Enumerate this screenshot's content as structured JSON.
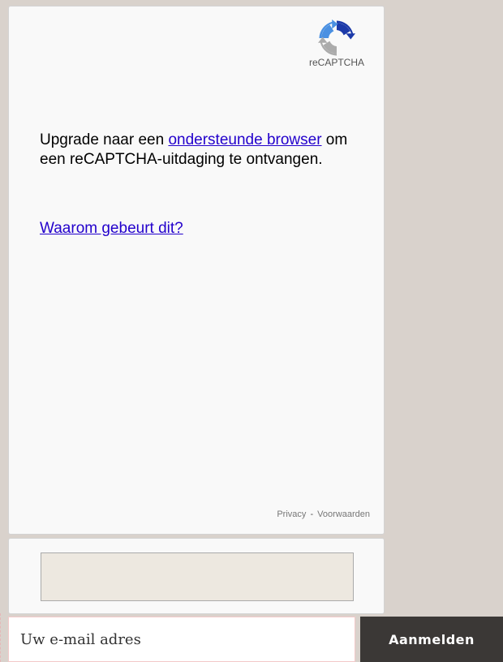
{
  "recaptcha": {
    "logo_label": "reCAPTCHA",
    "message_before": "Upgrade naar een ",
    "message_link": "ondersteunde browser",
    "message_after": " om een reCAPTCHA-uitdaging te ontvangen.",
    "why_link": "Waarom gebeurt dit?",
    "privacy_label": "Privacy",
    "separator": "-",
    "terms_label": "Voorwaarden",
    "logo_icon": "recaptcha-logo-icon",
    "colors": {
      "logo_blue": "#4a90e2",
      "logo_dark_blue": "#1c3aa9",
      "logo_grey": "#ababab"
    }
  },
  "response": {
    "textarea_value": ""
  },
  "signup": {
    "email_placeholder": "Uw e-mail adres",
    "submit_label": "Aanmelden"
  }
}
